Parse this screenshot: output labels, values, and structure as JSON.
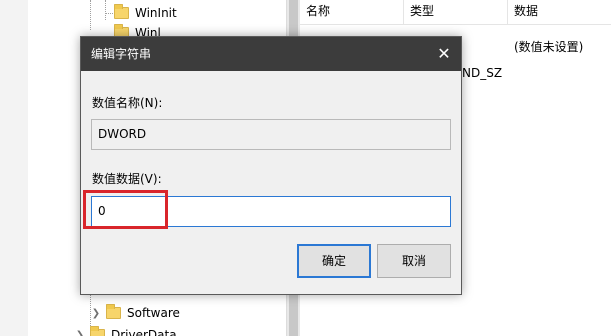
{
  "tree": {
    "items": [
      {
        "label": "WinInit"
      },
      {
        "label": "Winl"
      },
      {
        "label": "Software"
      },
      {
        "label": "DriverData"
      }
    ]
  },
  "values_list": {
    "columns": [
      "名称",
      "类型",
      "数据"
    ],
    "row1_data": "(数值未设置)",
    "row2_type_partial": "ND_SZ"
  },
  "dialog": {
    "title": "编辑字符串",
    "close_icon": "close-icon",
    "value_name_label": "数值名称(N):",
    "value_name": "DWORD",
    "value_data_label": "数值数据(V):",
    "value_data": "0",
    "ok_label": "确定",
    "cancel_label": "取消"
  },
  "colors": {
    "titlebar": "#3c3c3c",
    "accent": "#2b78d4",
    "highlight": "#d9252b",
    "folder": "#f7d56b"
  }
}
